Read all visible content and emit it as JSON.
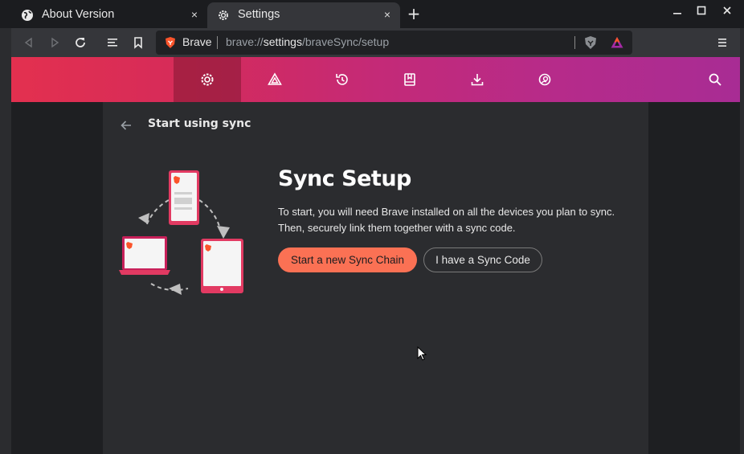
{
  "tabs": [
    {
      "title": "About Version",
      "icon": "globe-icon",
      "close": "×"
    },
    {
      "title": "Settings",
      "icon": "gear-icon",
      "close": "×"
    }
  ],
  "new_tab": "+",
  "window_controls": {
    "minimize": "—",
    "maximize": "□",
    "close": "×"
  },
  "toolbar": {
    "back": "back-icon",
    "forward": "forward-icon",
    "reload": "reload-icon",
    "reader": "reader-mode-icon",
    "bookmark": "bookmark-icon",
    "menu": "hamburger-menu-icon"
  },
  "omnibox": {
    "label": "Brave",
    "url_scheme": "brave://",
    "url_host": "settings",
    "url_path": "/braveSync/setup"
  },
  "settings_nav": {
    "items": [
      "gear-icon",
      "brave-rewards-icon",
      "history-icon",
      "bookmarks-icon",
      "downloads-icon",
      "wallet-icon"
    ],
    "active": 0,
    "search": "search-icon"
  },
  "page": {
    "title": "Start using sync",
    "setup_title": "Sync Setup",
    "description": "To start, you will need Brave installed on all the devices you plan to sync. Then, securely link them together with a sync code.",
    "primary_button": "Start a new Sync Chain",
    "secondary_button": "I have a Sync Code"
  },
  "colors": {
    "accent": "#fb7154",
    "nav_start": "#e3304f",
    "nav_end": "#a82c94",
    "background": "#2b2c2f"
  }
}
